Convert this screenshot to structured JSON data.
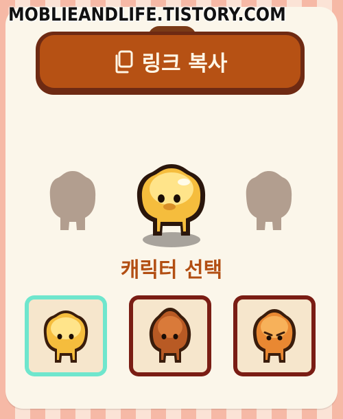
{
  "watermark": "MOBLIEANDLIFE.TISTORY.COM",
  "copy_button": {
    "label": "링크 복사",
    "icon": "copy-icon"
  },
  "section_title": "캐릭터 선택",
  "characters": [
    {
      "name": "yellow-character",
      "selected": true,
      "color": "#f2b52d"
    },
    {
      "name": "brown-character",
      "selected": false,
      "color": "#b85a24"
    },
    {
      "name": "orange-character",
      "selected": false,
      "color": "#e98832"
    }
  ],
  "colors": {
    "button": "#b65114",
    "button_border": "#6e2a13",
    "title": "#b24e12",
    "selected_border": "#6fe6cd",
    "unselected_border": "#7a1d14"
  }
}
